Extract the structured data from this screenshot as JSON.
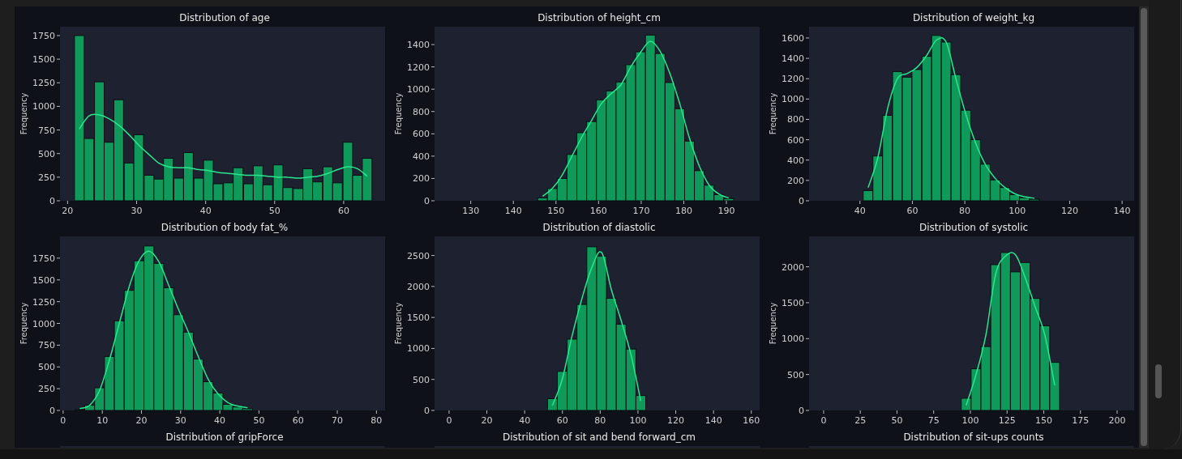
{
  "charts": [
    {
      "chart_data": {
        "type": "bar",
        "title": "Distribution of age",
        "ylabel": "Frequency",
        "x": [
          21.7,
          23.1,
          24.6,
          26.0,
          27.4,
          28.9,
          30.3,
          31.8,
          33.2,
          34.6,
          36.1,
          37.5,
          39.0,
          40.4,
          41.8,
          43.3,
          44.7,
          46.2,
          47.6,
          49.0,
          50.5,
          51.9,
          53.4,
          54.8,
          56.2,
          57.7,
          59.1,
          60.6,
          62.0,
          63.4
        ],
        "series": [
          {
            "type": "bar",
            "color": "#0f9a5b",
            "values": [
              1750,
              660,
              1260,
              620,
              1070,
              400,
              700,
              270,
              230,
              450,
              240,
              510,
              240,
              430,
              180,
              190,
              350,
              180,
              370,
              170,
              380,
              140,
              130,
              340,
              200,
              360,
              190,
              620,
              270,
              450
            ]
          },
          {
            "type": "line",
            "color": "#2ae68e",
            "values": [
              760,
              900,
              910,
              870,
              800,
              700,
              590,
              490,
              400,
              360,
              350,
              350,
              330,
              320,
              300,
              290,
              280,
              270,
              270,
              260,
              250,
              250,
              240,
              250,
              260,
              290,
              330,
              360,
              340,
              260
            ]
          }
        ],
        "xlim": [
          18.9,
          66.0
        ],
        "ylim": [
          0,
          1844
        ],
        "xticks": [
          20,
          30,
          40,
          50,
          60
        ],
        "yticks": [
          0,
          250,
          500,
          750,
          1000,
          1250,
          1500,
          1750
        ]
      }
    },
    {
      "chart_data": {
        "type": "bar",
        "title": "Distribution of height_cm",
        "ylabel": "Frequency",
        "x": [
          146.85,
          149.15,
          151.45,
          153.75,
          156.05,
          158.35,
          160.65,
          162.95,
          165.25,
          167.55,
          169.85,
          172.15,
          174.45,
          176.75,
          179.05,
          181.35,
          183.65,
          185.95,
          188.25,
          190.55
        ],
        "series": [
          {
            "type": "bar",
            "color": "#0f9a5b",
            "values": [
              25,
              110,
              200,
              415,
              610,
              710,
              905,
              985,
              1065,
              1220,
              1335,
              1485,
              1320,
              1060,
              825,
              535,
              270,
              140,
              55,
              20
            ]
          },
          {
            "type": "line",
            "color": "#2ae68e",
            "values": [
              40,
              110,
              230,
              400,
              570,
              720,
              870,
              960,
              1040,
              1200,
              1330,
              1430,
              1340,
              1140,
              870,
              560,
              310,
              140,
              60,
              25
            ]
          }
        ],
        "xlim": [
          121.5,
          197.8
        ],
        "ylim": [
          0,
          1560
        ],
        "xticks": [
          130,
          140,
          150,
          160,
          170,
          180,
          190
        ],
        "yticks": [
          0,
          200,
          400,
          600,
          800,
          1000,
          1200,
          1400
        ]
      }
    },
    {
      "chart_data": {
        "type": "bar",
        "title": "Distribution of weight_kg",
        "ylabel": "Frequency",
        "x": [
          43.1,
          46.8,
          50.5,
          54.3,
          58.0,
          61.7,
          65.5,
          69.2,
          72.9,
          76.6,
          80.4,
          84.1,
          87.8,
          91.6,
          95.3,
          99.0,
          102.7,
          106.5
        ],
        "series": [
          {
            "type": "bar",
            "color": "#0f9a5b",
            "values": [
              100,
              440,
              840,
              1270,
              1215,
              1290,
              1420,
              1625,
              1560,
              1240,
              890,
              600,
              360,
              205,
              130,
              60,
              30,
              15
            ]
          },
          {
            "type": "line",
            "color": "#2ae68e",
            "values": [
              130,
              420,
              900,
              1200,
              1250,
              1310,
              1430,
              1580,
              1560,
              1200,
              850,
              570,
              360,
              220,
              130,
              70,
              40,
              25
            ]
          }
        ],
        "xlim": [
          20.6,
          144.6
        ],
        "ylim": [
          0,
          1711
        ],
        "xticks": [
          40,
          60,
          80,
          100,
          120,
          140
        ],
        "yticks": [
          0,
          200,
          400,
          600,
          800,
          1000,
          1200,
          1400,
          1600
        ]
      }
    },
    {
      "chart_data": {
        "type": "bar",
        "title": "Distribution of body fat_%",
        "ylabel": "Frequency",
        "x": [
          4.26,
          6.78,
          9.3,
          11.82,
          14.34,
          16.86,
          19.38,
          21.9,
          24.42,
          26.94,
          29.46,
          31.98,
          34.5,
          37.02,
          39.54,
          42.06,
          44.58,
          47.1
        ],
        "series": [
          {
            "type": "bar",
            "color": "#0f9a5b",
            "values": [
              10,
              60,
              260,
              620,
              1030,
              1380,
              1720,
              1890,
              1690,
              1410,
              1100,
              900,
              590,
              330,
              200,
              70,
              40,
              20
            ]
          },
          {
            "type": "line",
            "color": "#2ae68e",
            "values": [
              20,
              60,
              230,
              580,
              1000,
              1420,
              1720,
              1830,
              1710,
              1440,
              1160,
              900,
              620,
              360,
              190,
              90,
              50,
              30
            ]
          }
        ],
        "xlim": [
          -0.8,
          82.2
        ],
        "ylim": [
          0,
          2000
        ],
        "xticks": [
          0,
          10,
          20,
          30,
          40,
          50,
          60,
          70,
          80
        ],
        "yticks": [
          0,
          250,
          500,
          750,
          1000,
          1250,
          1500,
          1750
        ]
      }
    },
    {
      "chart_data": {
        "type": "bar",
        "title": "Distribution of diastolic",
        "ylabel": "Frequency",
        "x": [
          54.7,
          59.9,
          65.1,
          70.3,
          75.5,
          80.7,
          85.9,
          91.1,
          96.3,
          101.5
        ],
        "series": [
          {
            "type": "bar",
            "color": "#0f9a5b",
            "values": [
              190,
              630,
              1150,
              1710,
              2640,
              2490,
              1810,
              1390,
              990,
              240
            ]
          },
          {
            "type": "line",
            "color": "#2ae68e",
            "values": [
              80,
              500,
              1200,
              1800,
              2300,
              2550,
              1950,
              1450,
              900,
              150
            ]
          }
        ],
        "xlim": [
          -7.7,
          164.4
        ],
        "ylim": [
          0,
          2808
        ],
        "xticks": [
          0,
          20,
          40,
          60,
          80,
          100,
          120,
          140,
          160
        ],
        "yticks": [
          0,
          500,
          1000,
          1500,
          2000,
          2500
        ]
      }
    },
    {
      "chart_data": {
        "type": "bar",
        "title": "Distribution of systolic",
        "ylabel": "Frequency",
        "x": [
          97.15,
          103.85,
          110.55,
          117.25,
          123.95,
          130.65,
          137.35,
          144.05,
          150.75,
          157.45
        ],
        "series": [
          {
            "type": "bar",
            "color": "#0f9a5b",
            "values": [
              170,
              580,
              890,
              2030,
              2200,
              1930,
              2060,
              1560,
              1180,
              670
            ]
          },
          {
            "type": "line",
            "color": "#2ae68e",
            "values": [
              70,
              500,
              1050,
              1900,
              2150,
              2170,
              1850,
              1450,
              1050,
              350
            ]
          }
        ],
        "xlim": [
          -9.9,
          211.6
        ],
        "ylim": [
          0,
          2424
        ],
        "xticks": [
          0,
          25,
          50,
          75,
          100,
          125,
          150,
          175,
          200
        ],
        "yticks": [
          0,
          500,
          1000,
          1500,
          2000
        ]
      }
    }
  ],
  "partial_plots": [
    {
      "title": "Distribution of gripForce"
    },
    {
      "title": "Distribution of sit and bend forward_cm"
    },
    {
      "title": "Distribution of sit-ups counts"
    }
  ]
}
